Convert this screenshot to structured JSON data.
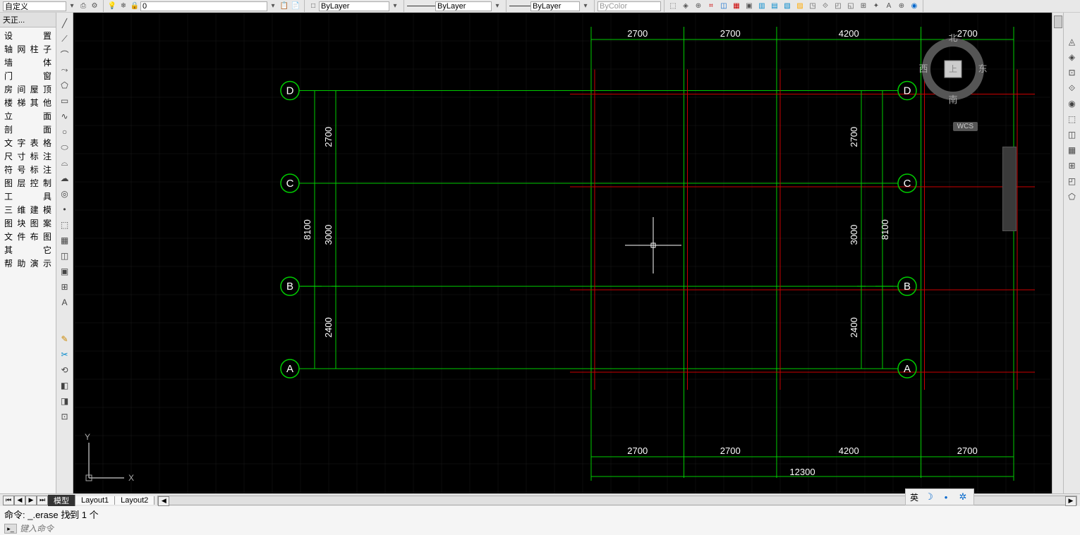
{
  "toolbar": {
    "custom_label": "自定义",
    "layer_value": "0",
    "linetype1": "ByLayer",
    "linetype2": "ByLayer",
    "linetype3": "ByLayer",
    "bycolor": "ByColor"
  },
  "left_panel": {
    "title": "天正...",
    "items": [
      "设　　置",
      "轴网柱子",
      "墙　　体",
      "门　　窗",
      "房间屋顶",
      "楼梯其他",
      "立　　面",
      "剖　　面",
      "文字表格",
      "尺寸标注",
      "符号标注",
      "图层控制",
      "工　　具",
      "三维建模",
      "图块图案",
      "文件布图",
      "其　　它",
      "帮助演示"
    ]
  },
  "tabs": {
    "model": "模型",
    "layout1": "Layout1",
    "layout2": "Layout2"
  },
  "command": {
    "line": "命令: _.erase 找到 1 个",
    "placeholder": "键入命令"
  },
  "status": {
    "ime": "英"
  },
  "compass": {
    "n": "北",
    "s": "南",
    "e": "东",
    "w": "西",
    "top": "上"
  },
  "wcs": "WCS",
  "ucs": {
    "x": "X",
    "y": "Y"
  },
  "chart_data": {
    "type": "grid-plan",
    "horizontal_axes": [
      "A",
      "B",
      "C",
      "D"
    ],
    "vertical_spacing_mm": [
      2400,
      3000,
      2700
    ],
    "vertical_total_mm": 8100,
    "column_spacing_mm": [
      2700,
      2700,
      4200,
      2700
    ],
    "horizontal_total_mm": 12300,
    "dims_top": [
      "2700",
      "2700",
      "4200",
      "2700"
    ],
    "dims_bottom": [
      "2700",
      "2700",
      "4200",
      "2700"
    ],
    "dim_total": "12300",
    "dims_left_inner": [
      "2400",
      "3000",
      "2700"
    ],
    "dim_left_outer": "8100",
    "dims_right_inner": [
      "2400",
      "3000",
      "2700"
    ],
    "dim_right_outer": "8100"
  }
}
